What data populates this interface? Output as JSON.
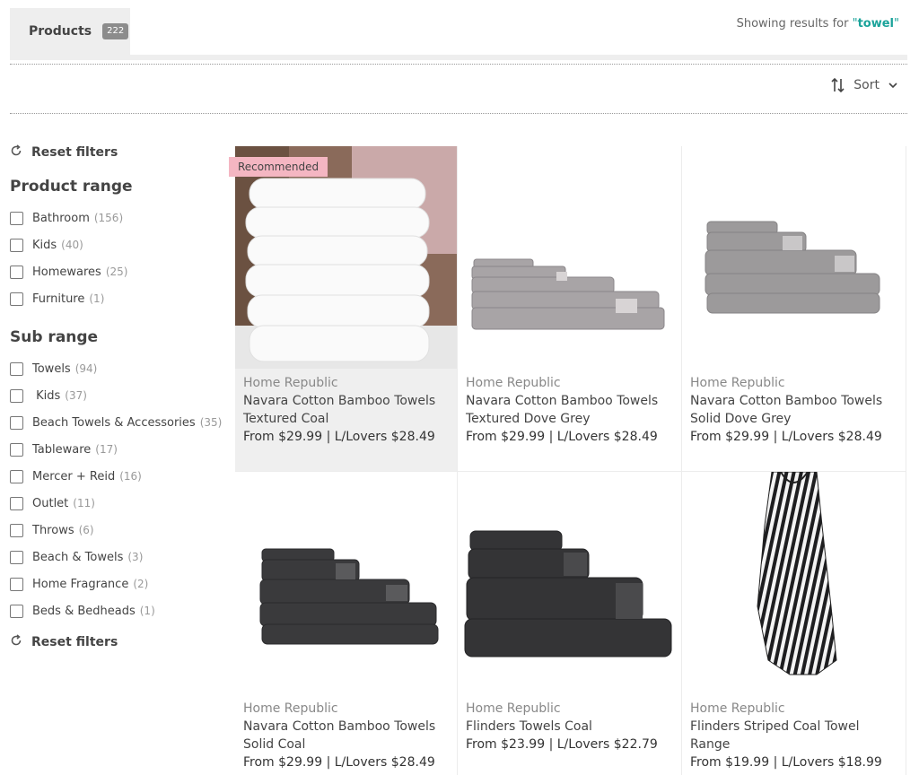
{
  "header": {
    "tab_label": "Products",
    "tab_count": "222",
    "results_prefix": "Showing results for ",
    "results_query": "towel",
    "quote": "\""
  },
  "sort": {
    "label": "Sort"
  },
  "sidebar": {
    "reset_top": "Reset filters",
    "reset_bottom": "Reset filters",
    "product_range": {
      "title": "Product range",
      "items": [
        {
          "label": "Bathroom",
          "count": "(156)"
        },
        {
          "label": "Kids",
          "count": "(40)"
        },
        {
          "label": "Homewares",
          "count": "(25)"
        },
        {
          "label": "Furniture",
          "count": "(1)"
        }
      ]
    },
    "sub_range": {
      "title": "Sub range",
      "items": [
        {
          "label": "Towels",
          "count": "(94)"
        },
        {
          "label": " Kids",
          "count": "(37)"
        },
        {
          "label": "Beach Towels & Accessories",
          "count": "(35)"
        },
        {
          "label": "Tableware",
          "count": "(17)"
        },
        {
          "label": "Mercer + Reid",
          "count": "(16)"
        },
        {
          "label": "Outlet",
          "count": "(11)"
        },
        {
          "label": "Throws",
          "count": "(6)"
        },
        {
          "label": "Beach & Towels",
          "count": "(3)"
        },
        {
          "label": "Home Fragrance",
          "count": "(2)"
        },
        {
          "label": "Beds & Bedheads",
          "count": "(1)"
        }
      ]
    }
  },
  "products": [
    {
      "badge": "Recommended",
      "brand": "Home Republic",
      "name": "Navara Cotton Bamboo Towels Textured Coal",
      "price": "From $29.99 | L/Lovers $28.49"
    },
    {
      "brand": "Home Republic",
      "name": "Navara Cotton Bamboo Towels Textured Dove Grey",
      "price": "From $29.99 | L/Lovers $28.49"
    },
    {
      "brand": "Home Republic",
      "name": "Navara Cotton Bamboo Towels Solid Dove Grey",
      "price": "From $29.99 | L/Lovers $28.49"
    },
    {
      "brand": "Home Republic",
      "name": "Navara Cotton Bamboo Towels Solid Coal",
      "price": "From $29.99 | L/Lovers $28.49"
    },
    {
      "brand": "Home Republic",
      "name": "Flinders Towels Coal",
      "price": "From $23.99 | L/Lovers $22.79"
    },
    {
      "brand": "Home Republic",
      "name": "Flinders Striped Coal Towel Range",
      "price": "From $19.99 | L/Lovers $18.99"
    }
  ],
  "colors": {
    "accent": "#1aa39a",
    "badge": "#f4b6c2",
    "tab_bg": "#eeeeee"
  }
}
